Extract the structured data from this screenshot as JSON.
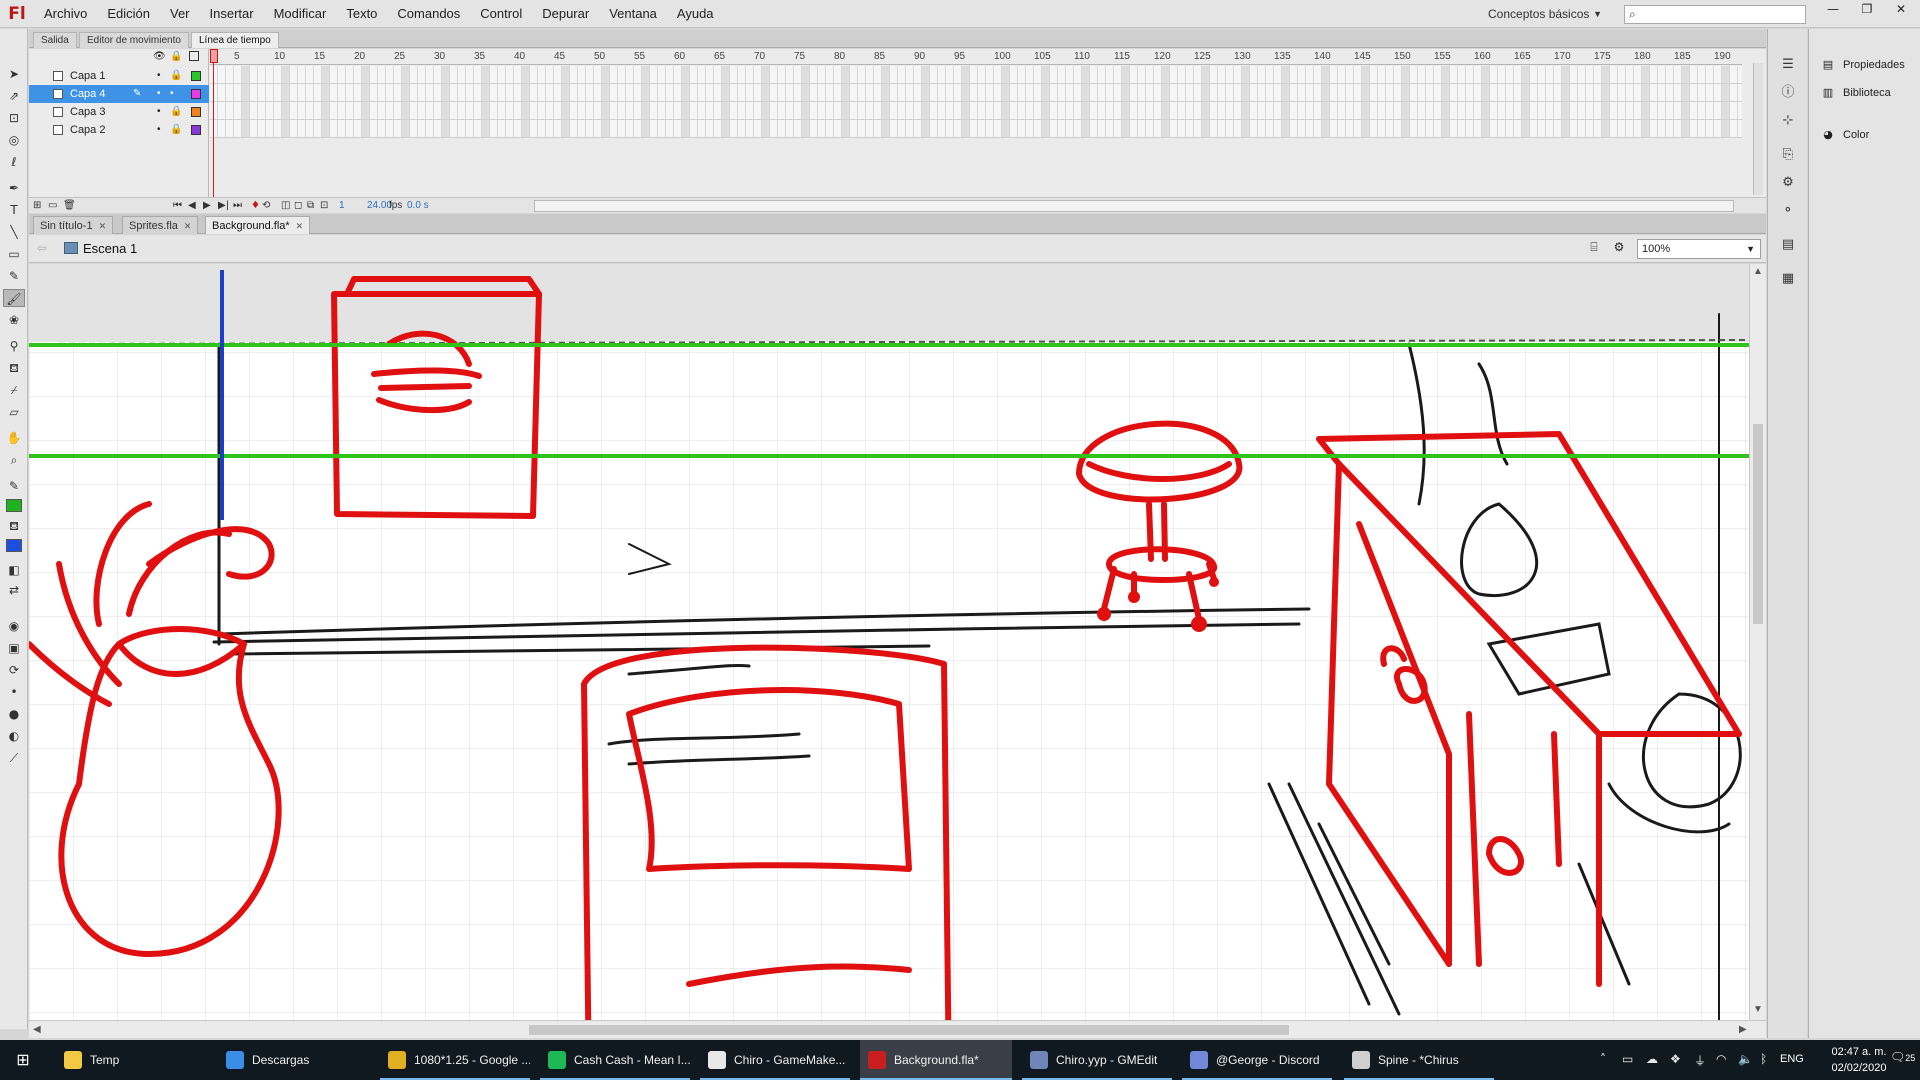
{
  "menubar": {
    "logo": "Fl",
    "items": [
      "Archivo",
      "Edición",
      "Ver",
      "Insertar",
      "Modificar",
      "Texto",
      "Comandos",
      "Control",
      "Depurar",
      "Ventana",
      "Ayuda"
    ],
    "workspace": "Conceptos básicos",
    "search_placeholder": "",
    "window_buttons": [
      "—",
      "❐",
      "✕"
    ]
  },
  "panel_tabs": [
    "Salida",
    "Editor de movimiento",
    "Línea de tiempo"
  ],
  "timeline": {
    "layers": [
      {
        "name": "Capa 1",
        "color": "#28c828",
        "selected": false
      },
      {
        "name": "Capa 4",
        "color": "#e83ae8",
        "selected": true
      },
      {
        "name": "Capa 3",
        "color": "#f0821e",
        "selected": false
      },
      {
        "name": "Capa 2",
        "color": "#8a3ad8",
        "selected": false
      }
    ],
    "current_frame_label": "1",
    "frame_numbers": [
      "5",
      "10",
      "15",
      "20",
      "25",
      "30",
      "35",
      "40",
      "45",
      "50",
      "55",
      "60",
      "65",
      "70",
      "75",
      "80",
      "85",
      "90",
      "95",
      "100",
      "105",
      "110",
      "115",
      "120",
      "125",
      "130",
      "135",
      "140",
      "145",
      "150",
      "155",
      "160",
      "165",
      "170",
      "175",
      "180",
      "185",
      "190"
    ],
    "footer": {
      "frame": "1",
      "fps": "24.00",
      "fps_unit": "fps",
      "time": "0.0 s"
    }
  },
  "doc_tabs": [
    {
      "label": "Sin título-1",
      "active": false
    },
    {
      "label": "Sprites.fla",
      "active": false
    },
    {
      "label": "Background.fla*",
      "active": true
    }
  ],
  "edit_bar": {
    "scene": "Escena 1",
    "zoom": "100%"
  },
  "side_panel": {
    "items": [
      "Propiedades",
      "Biblioteca",
      "Color"
    ]
  },
  "colors": {
    "accent_select": "#3f93e6",
    "sketch_red": "#e01010",
    "guide_green": "#2ec41a",
    "guide_blue": "#1d3fc8",
    "fill_color": "#1fb31f",
    "stroke_color": "#1a4fe0"
  },
  "taskbar": {
    "items": [
      {
        "label": "Temp",
        "icon": "folder-icon",
        "color": "#f3c944"
      },
      {
        "label": "Descargas",
        "icon": "download-icon",
        "color": "#3a8ee6"
      },
      {
        "label": "1080*1.25 - Google ...",
        "icon": "chrome-icon",
        "color": "#e0b020"
      },
      {
        "label": "Cash Cash - Mean I...",
        "icon": "spotify-icon",
        "color": "#1db954"
      },
      {
        "label": "Chiro - GameMake...",
        "icon": "gamemaker-icon",
        "color": "#e8e8e8"
      },
      {
        "label": "Background.fla*",
        "icon": "flash-icon",
        "color": "#c81e1e"
      },
      {
        "label": "Chiro.yyp - GMEdit",
        "icon": "gmedit-icon",
        "color": "#6f86b8"
      },
      {
        "label": "@George - Discord",
        "icon": "discord-icon",
        "color": "#7289da"
      },
      {
        "label": "Spine - *Chirus",
        "icon": "spine-icon",
        "color": "#cfcfcf"
      }
    ],
    "language": "ENG",
    "time": "02:47 a. m.",
    "date": "02/02/2020",
    "notifications": "25"
  }
}
